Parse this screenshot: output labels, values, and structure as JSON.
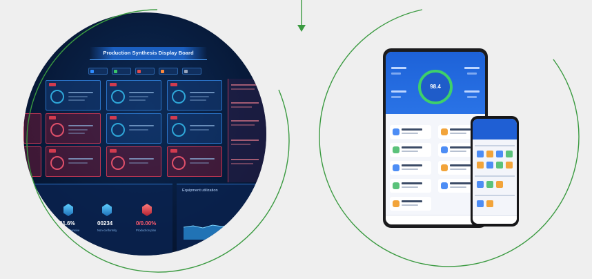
{
  "dashboard": {
    "title": "Production Synthesis Display Board",
    "stats": [
      {
        "value": "91.6%",
        "caption": "Comprehensive"
      },
      {
        "value": "00234",
        "caption": "Non-conformity"
      },
      {
        "value": "0/0.00%",
        "caption": "Production plan"
      }
    ],
    "panels": {
      "left_label": "",
      "right_label": "Equipment utilization"
    }
  },
  "tablet": {
    "gauge_value": "98.4"
  },
  "colors": {
    "arc_green": "#3a9a40",
    "dashboard_bg": "#071a3a",
    "app_blue": "#1d62d8",
    "ring_green": "#3ed06a",
    "alert_red": "#c03552"
  },
  "icons": [
    "down-arrow-icon"
  ]
}
